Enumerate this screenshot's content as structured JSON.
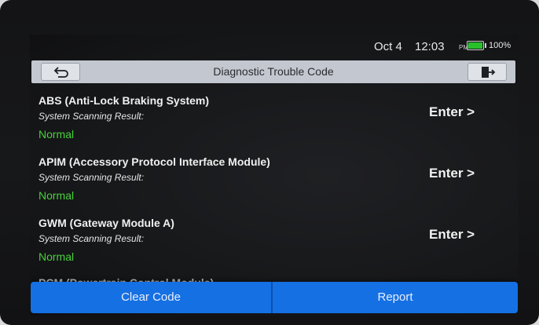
{
  "status_bar": {
    "date": "Oct 4",
    "time": "12:03",
    "ampm": "PM",
    "battery": "100%",
    "battery_level": 1.0,
    "battery_color": "#27c02b"
  },
  "header": {
    "title": "Diagnostic Trouble Code",
    "back_icon": "back-arrow-icon",
    "exit_icon": "exit-door-icon"
  },
  "modules": [
    {
      "name": "ABS (Anti-Lock Braking System)",
      "result_label": "System Scanning Result:",
      "status": "Normal",
      "action": "Enter >"
    },
    {
      "name": "APIM (Accessory Protocol Interface Module)",
      "result_label": "System Scanning Result:",
      "status": "Normal",
      "action": "Enter >"
    },
    {
      "name": "GWM (Gateway Module A)",
      "result_label": "System Scanning Result:",
      "status": "Normal",
      "action": "Enter >"
    }
  ],
  "partial_item": "PCM (Powertrain Control Module)",
  "footer": {
    "clear_label": "Clear Code",
    "report_label": "Report"
  },
  "colors": {
    "status_normal": "#48d23a",
    "accent": "#1570e3",
    "title_bar": "#c3c7cf"
  }
}
